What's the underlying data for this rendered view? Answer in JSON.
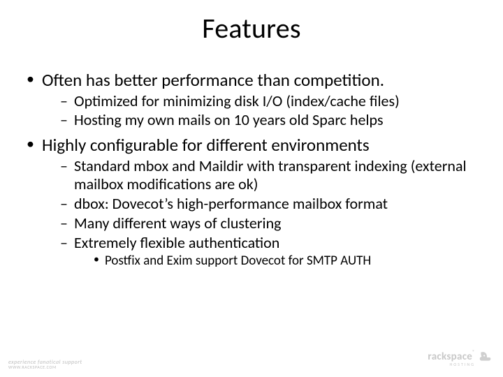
{
  "title": "Features",
  "bullets": {
    "b1": "Often has better performance than competition.",
    "b1_1": "Optimized for minimizing disk I/O (index/cache files)",
    "b1_2": "Hosting my own mails on 10 years old Sparc helps",
    "b2": "Highly configurable for different environments",
    "b2_1": "Standard mbox and Maildir with transparent indexing (external mailbox modifications are ok)",
    "b2_2": "dbox: Dovecot’s high-performance mailbox format",
    "b2_3": "Many different ways of clustering",
    "b2_4": "Extremely flexible authentication",
    "b2_4_1": "Postfix and Exim support Dovecot for SMTP AUTH"
  },
  "footer": {
    "left_line1": "experience fanatical support",
    "left_line2": "WWW.RACKSPACE.COM",
    "brand_main": "rackspace",
    "brand_sub": "HOSTING",
    "reg": "®"
  }
}
